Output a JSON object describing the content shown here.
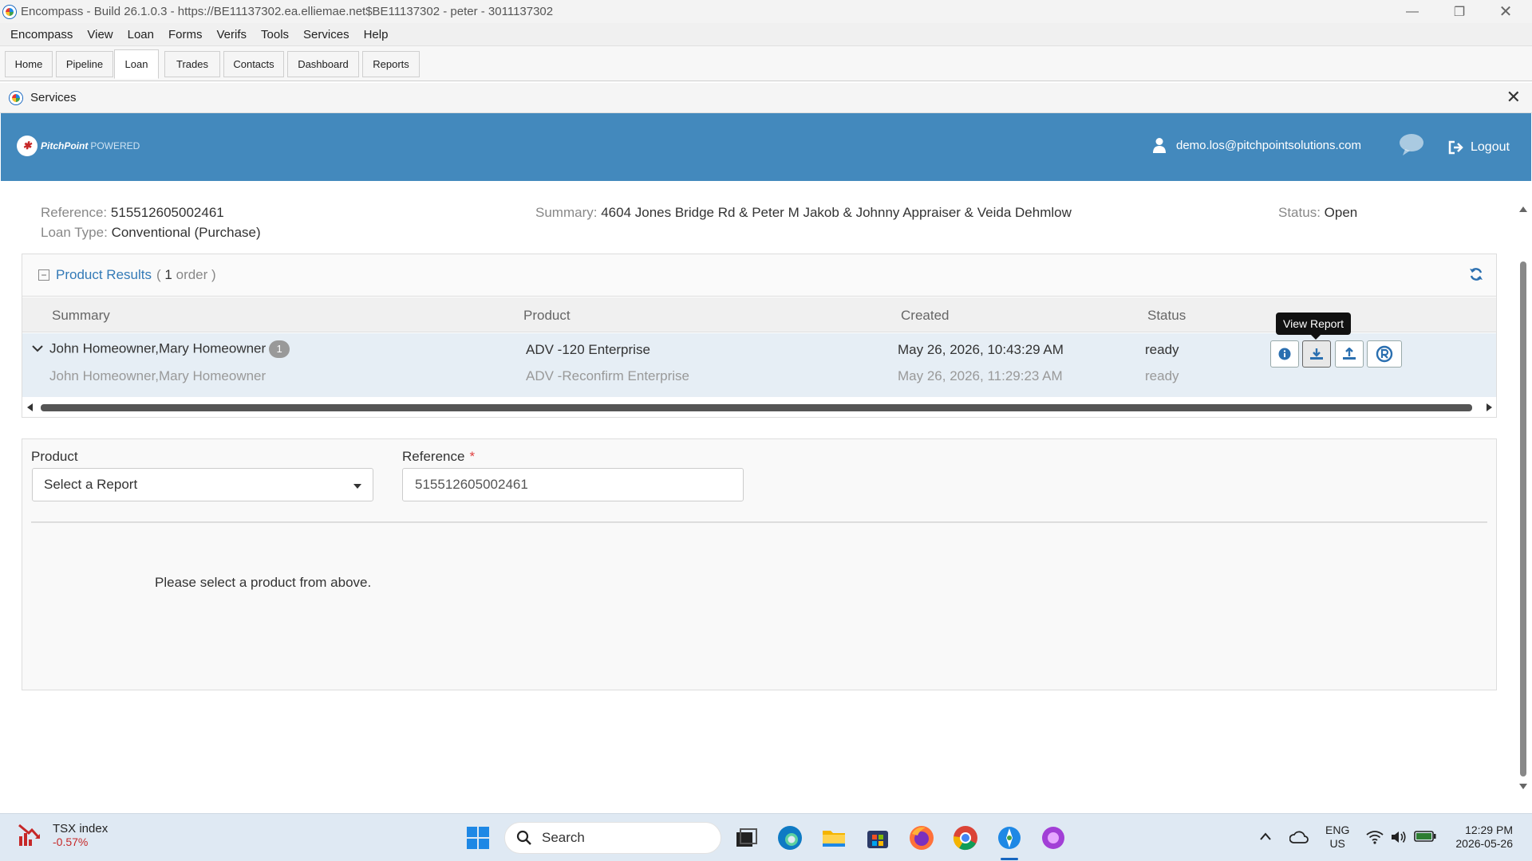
{
  "window": {
    "title": "Encompass - Build 26.1.0.3 - https://BE11137302.ea.elliemae.net$BE11137302 - peter - 3011137302"
  },
  "menu": [
    "Encompass",
    "View",
    "Loan",
    "Forms",
    "Verifs",
    "Tools",
    "Services",
    "Help"
  ],
  "tabs": [
    "Home",
    "Pipeline",
    "Loan",
    "Trades",
    "Contacts",
    "Dashboard",
    "Reports"
  ],
  "services_title": "Services",
  "banner": {
    "brand": "PitchPoint",
    "powered": "POWERED",
    "user_email": "demo.los@pitchpointsolutions.com",
    "logout_label": "Logout"
  },
  "info": {
    "reference_label": "Reference:",
    "reference_value": "515512605002461",
    "loantype_label": "Loan Type:",
    "loantype_value": "Conventional (Purchase)",
    "summary_label": "Summary:",
    "summary_value": "4604 Jones Bridge Rd & Peter M Jakob & Johnny Appraiser & Veida Dehmlow",
    "status_label": "Status:",
    "status_value": "Open"
  },
  "results": {
    "title": "Product Results",
    "count_open": "(",
    "count": "1",
    "count_suffix": "order )",
    "columns": [
      "Summary",
      "Product",
      "Created",
      "Status"
    ],
    "rows": [
      {
        "summary": "John Homeowner,Mary Homeowner",
        "badge": "1",
        "product": "ADV -120 Enterprise",
        "created": "May 26, 2026, 10:43:29 AM",
        "status": "ready"
      },
      {
        "summary": "John Homeowner,Mary Homeowner",
        "product": "ADV -Reconfirm Enterprise",
        "created": "May 26, 2026, 11:29:23 AM",
        "status": "ready"
      }
    ],
    "tooltip": "View Report"
  },
  "form": {
    "product_label": "Product",
    "product_selected": "Select a Report",
    "reference_label": "Reference",
    "required_mark": "*",
    "reference_value": "515512605002461",
    "hint": "Please select a product from above."
  },
  "taskbar": {
    "stock_name": "TSX index",
    "stock_change": "-0.57%",
    "search_placeholder": "Search",
    "lang1": "ENG",
    "lang2": "US",
    "time": "12:29 PM",
    "date": "2026-05-26"
  }
}
